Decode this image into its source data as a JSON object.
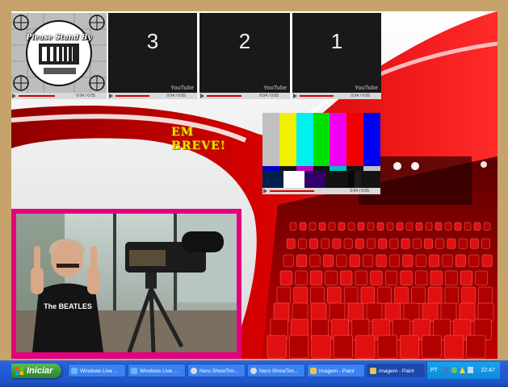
{
  "canvas": {
    "overlay_text": "EM\nBREVE!",
    "test_card_caption": "Please Stand By",
    "countdown_videos": [
      {
        "number": "3",
        "brand": "YouTube",
        "time": "0:04 / 0:05"
      },
      {
        "number": "2",
        "brand": "YouTube",
        "time": "0:04 / 0:05"
      },
      {
        "number": "1",
        "brand": "YouTube",
        "time": "0:04 / 0:05"
      }
    ],
    "test_card_time": "0:04 / 0:05",
    "color_bars_time": "0:04 / 0:05",
    "shirt_text": "The BEATLES",
    "colors": {
      "red_wave": "#d40000",
      "frame": "#c6a36a",
      "webcam_border": "#e4007c",
      "overlay_text": "#f1e400"
    }
  },
  "taskbar": {
    "start_label": "Iniciar",
    "tasks": [
      {
        "label": "Windows Live ...",
        "icon": "windows-live-icon"
      },
      {
        "label": "Windows Live ...",
        "icon": "windows-live-icon"
      },
      {
        "label": "Nero ShowTim...",
        "icon": "nero-icon"
      },
      {
        "label": "Nero ShowTim...",
        "icon": "nero-icon"
      },
      {
        "label": "imagem - Paint",
        "icon": "paint-icon"
      },
      {
        "label": "imagem - Paint",
        "icon": "paint-icon",
        "active": true
      }
    ],
    "tray": {
      "language": "PT",
      "clock": "22:47"
    }
  }
}
